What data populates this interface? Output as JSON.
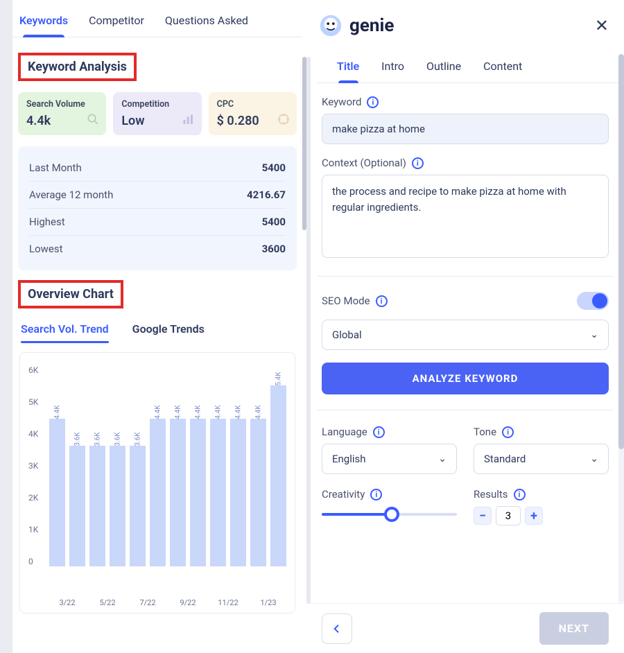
{
  "brand": {
    "name": "genie"
  },
  "left": {
    "tabs": [
      "Keywords",
      "Competitor",
      "Questions Asked"
    ],
    "active_tab": 0,
    "section_title": "Keyword Analysis",
    "cards": {
      "search_volume": {
        "label": "Search Volume",
        "value": "4.4k"
      },
      "competition": {
        "label": "Competition",
        "value": "Low"
      },
      "cpc": {
        "label": "CPC",
        "value": "$ 0.280"
      }
    },
    "stats": [
      {
        "k": "Last Month",
        "v": "5400"
      },
      {
        "k": "Average 12 month",
        "v": "4216.67"
      },
      {
        "k": "Highest",
        "v": "5400"
      },
      {
        "k": "Lowest",
        "v": "3600"
      }
    ],
    "overview_title": "Overview Chart",
    "subtabs": [
      "Search Vol. Trend",
      "Google Trends"
    ],
    "active_subtab": 0
  },
  "chart_data": {
    "type": "bar",
    "categories": [
      "3/22",
      "4/22",
      "5/22",
      "6/22",
      "7/22",
      "8/22",
      "9/22",
      "10/22",
      "11/22",
      "12/22",
      "1/23",
      "2/23"
    ],
    "values": [
      4400,
      3600,
      3600,
      3600,
      3600,
      4400,
      4400,
      4400,
      4400,
      4400,
      4400,
      5400
    ],
    "data_labels": [
      "4.4K",
      "3.6K",
      "3.6K",
      "3.6K",
      "3.6K",
      "4.4K",
      "4.4K",
      "4.4K",
      "4.4K",
      "4.4K",
      "4.4K",
      "5.4K"
    ],
    "ylabel": "",
    "ylim": [
      0,
      6000
    ],
    "yticks": [
      "6K",
      "5K",
      "4K",
      "3K",
      "2K",
      "1K",
      "0"
    ],
    "xticks_shown": [
      "3/22",
      "5/22",
      "7/22",
      "9/22",
      "11/22",
      "1/23"
    ]
  },
  "right": {
    "tabs": [
      "Title",
      "Intro",
      "Outline",
      "Content"
    ],
    "active_tab": 0,
    "keyword_label": "Keyword",
    "keyword_value": "make pizza at home",
    "context_label": "Context (Optional)",
    "context_value": "the process and recipe to make pizza at home with regular ingredients.",
    "seo_mode_label": "SEO Mode",
    "seo_mode_on": true,
    "region_value": "Global",
    "analyze_btn": "ANALYZE KEYWORD",
    "language_label": "Language",
    "language_value": "English",
    "tone_label": "Tone",
    "tone_value": "Standard",
    "creativity_label": "Creativity",
    "creativity_pct": 52,
    "results_label": "Results",
    "results_value": "3",
    "next_btn": "NEXT"
  }
}
